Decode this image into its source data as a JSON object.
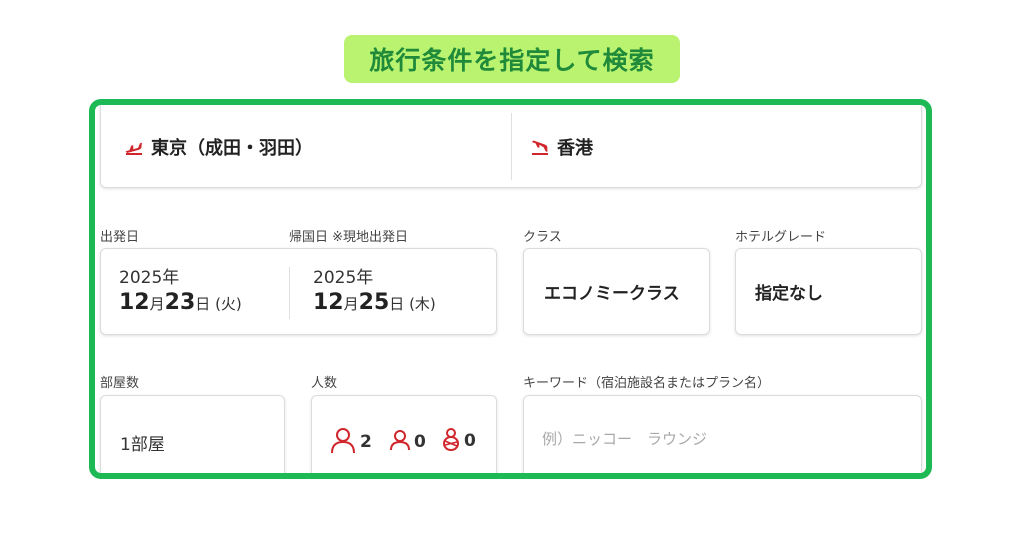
{
  "heading": "旅行条件を指定して検索",
  "route": {
    "origin": "東京（成田・羽田）",
    "destination": "香港"
  },
  "dates": {
    "departure_label": "出発日",
    "return_label": "帰国日 ※現地出発日",
    "departure": {
      "year": "2025年",
      "month": "12",
      "month_unit": "月",
      "day": "23",
      "day_unit": "日",
      "weekday": "(火)"
    },
    "return": {
      "year": "2025年",
      "month": "12",
      "month_unit": "月",
      "day": "25",
      "day_unit": "日",
      "weekday": "(木)"
    }
  },
  "class": {
    "label": "クラス",
    "value": "エコノミークラス"
  },
  "hotel_grade": {
    "label": "ホテルグレード",
    "value": "指定なし"
  },
  "rooms": {
    "label": "部屋数",
    "value": "1部屋"
  },
  "people": {
    "label": "人数",
    "adults": "2",
    "children": "0",
    "infants": "0"
  },
  "keyword": {
    "label": "キーワード（宿泊施設名またはプラン名）",
    "placeholder": "例）ニッコー　ラウンジ"
  },
  "colors": {
    "accent_green": "#1db954",
    "heading_bg": "#b9f36f",
    "heading_text": "#1f8a3a",
    "icon_red": "#d0262c"
  }
}
